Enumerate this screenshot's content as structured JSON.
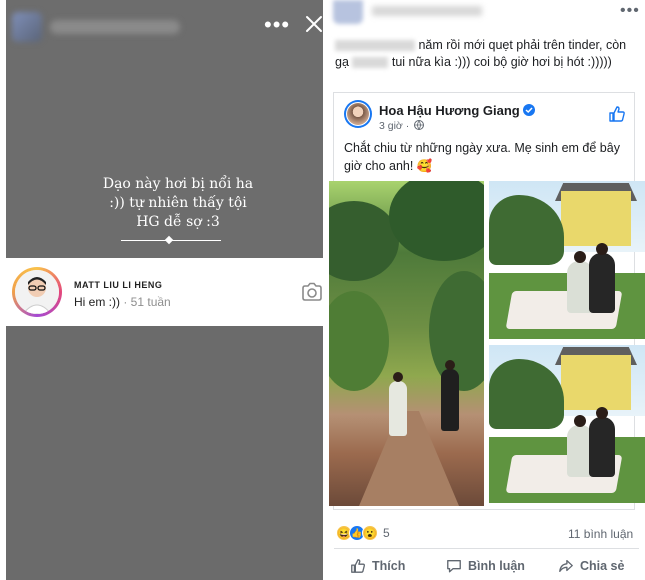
{
  "story": {
    "overlay_text": "Dạo này hơi bị nổi ha :)) tự nhiên thấy tội HG dễ sợ :3",
    "reply": {
      "author": "MATT LIU LI HENG",
      "message": "Hi em :))",
      "time": "· 51 tuần"
    },
    "icons": [
      "more-icon",
      "close-icon",
      "camera-icon"
    ]
  },
  "fb_post": {
    "caption_part1": "năm rồi mới quẹt phải trên tinder, còn gạ",
    "caption_part2": "tui nữa kìa :))) coi bộ giờ hơi bị hót :)))))",
    "shared": {
      "page_name": "Hoa Hậu Hương Giang",
      "time": "3 giờ ·",
      "text": "Chắt chiu từ những ngày xưa. Mẹ sinh em để bây giờ cho anh! 🥰"
    },
    "reactions": {
      "emojis": [
        "😆",
        "👍",
        "😮"
      ],
      "count": "5"
    },
    "comments": "11 bình luận",
    "actions": {
      "like": "Thích",
      "comment": "Bình luận",
      "share": "Chia sẻ"
    },
    "colors": {
      "facebook_blue": "#1877f2",
      "meta_gray": "#606770",
      "story_gray": "#6b6b6b"
    }
  }
}
